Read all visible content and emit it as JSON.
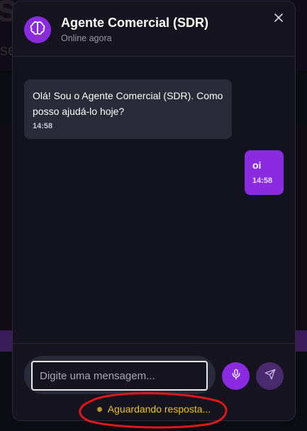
{
  "header": {
    "title": "Agente Comercial (SDR)",
    "status": "Online agora",
    "avatar_icon": "brain-icon",
    "close_icon": "close-icon"
  },
  "messages": [
    {
      "sender": "bot",
      "text": "Olá! Sou o Agente Comercial (SDR). Como posso ajudá-lo hoje?",
      "time": "14:58"
    },
    {
      "sender": "user",
      "text": "oi",
      "time": "14:58"
    }
  ],
  "composer": {
    "placeholder": "Digite uma mensagem...",
    "value": "",
    "mic_icon": "microphone-icon",
    "send_icon": "send-icon"
  },
  "status_line": "Aguardando resposta...",
  "colors": {
    "accent": "#8a2be2",
    "send_disabled": "#4a2a6e",
    "status_text": "#f0c419",
    "annotation": "#e0161b"
  }
}
